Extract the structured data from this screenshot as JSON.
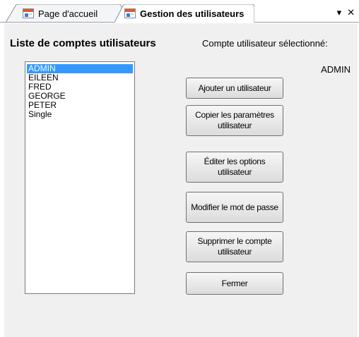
{
  "tabs": {
    "home": {
      "label": "Page d'accueil",
      "icon": "app-window-icon"
    },
    "users": {
      "label": "Gestion des utilisateurs",
      "icon": "app-window-icon"
    }
  },
  "window_controls": {
    "dropdown": "▾",
    "close": "✕"
  },
  "panel": {
    "list_title": "Liste de comptes utilisateurs",
    "selected_title": "Compte utilisateur sélectionné:",
    "selected_value": "ADMIN"
  },
  "accounts": [
    "ADMIN",
    "EILEEN",
    "FRED",
    "GEORGE",
    "PETER",
    "Single"
  ],
  "selected_index": 0,
  "buttons": {
    "add": "Ajouter un utilisateur",
    "copy": "Copier les paramètres utilisateur",
    "edit": "Éditer les options utilisateur",
    "password": "Modifier le mot de passe",
    "delete": "Supprimer le compte utilisateur",
    "close": "Fermer"
  },
  "colors": {
    "selection": "#3399ff",
    "panel": "#f0f0f0"
  }
}
